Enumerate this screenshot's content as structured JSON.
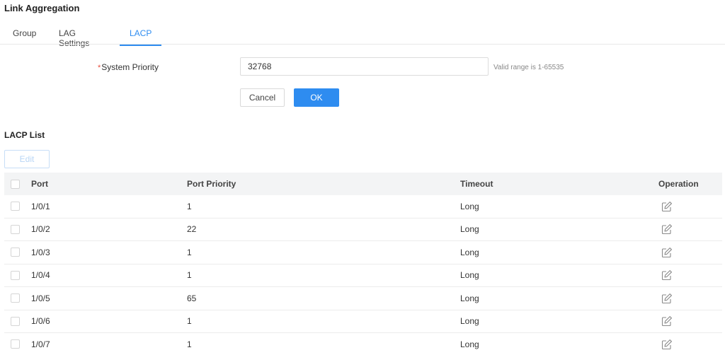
{
  "page": {
    "title": "Link Aggregation"
  },
  "tabs": [
    {
      "label": "Group"
    },
    {
      "label": "LAG Settings"
    },
    {
      "label": "LACP"
    }
  ],
  "form": {
    "required_mark": "*",
    "label": "System Priority",
    "value": "32768",
    "hint": "Valid range is 1-65535",
    "cancel_label": "Cancel",
    "ok_label": "OK"
  },
  "list": {
    "title": "LACP List",
    "edit_label": "Edit",
    "columns": {
      "port": "Port",
      "priority": "Port Priority",
      "timeout": "Timeout",
      "operation": "Operation"
    },
    "rows": [
      {
        "port": "1/0/1",
        "priority": "1",
        "timeout": "Long"
      },
      {
        "port": "1/0/2",
        "priority": "22",
        "timeout": "Long"
      },
      {
        "port": "1/0/3",
        "priority": "1",
        "timeout": "Long"
      },
      {
        "port": "1/0/4",
        "priority": "1",
        "timeout": "Long"
      },
      {
        "port": "1/0/5",
        "priority": "65",
        "timeout": "Long"
      },
      {
        "port": "1/0/6",
        "priority": "1",
        "timeout": "Long"
      },
      {
        "port": "1/0/7",
        "priority": "1",
        "timeout": "Long"
      }
    ]
  },
  "colors": {
    "accent": "#2e8cf0",
    "required": "#e84d3d"
  },
  "icons": {
    "row_operation": "edit-icon"
  }
}
